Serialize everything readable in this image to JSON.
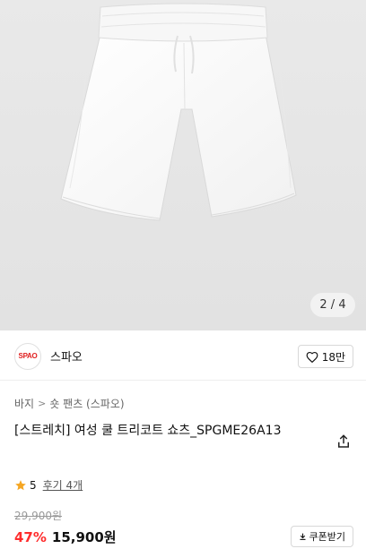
{
  "gallery": {
    "pager_text": "2 / 4"
  },
  "brand": {
    "logo_text": "SPAO",
    "name": "스파오",
    "like_count": "18만"
  },
  "breadcrumb": {
    "items": [
      "바지",
      "숏 팬츠 (스파오)"
    ]
  },
  "product": {
    "title": "[스트레치] 여성 쿨 트리코트 쇼츠_SPGME26A13"
  },
  "rating": {
    "score": "5",
    "reviews": "후기 4개"
  },
  "price": {
    "original": "29,900원",
    "discount": "47%",
    "sale": "15,900원",
    "coupon_label": "쿠폰받기"
  },
  "colors": {
    "accent_red": "#ff2d2d",
    "star": "#f5a623",
    "background_gray": "#e6e6e6"
  }
}
